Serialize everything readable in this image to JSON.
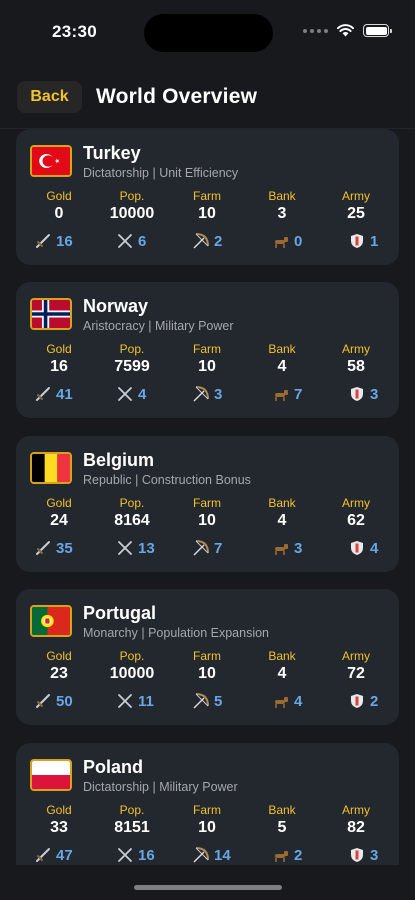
{
  "status_bar": {
    "time": "23:30"
  },
  "nav": {
    "back_label": "Back",
    "title": "World Overview"
  },
  "stat_labels": {
    "gold": "Gold",
    "pop": "Pop.",
    "farm": "Farm",
    "bank": "Bank",
    "army": "Army"
  },
  "unit_icons": [
    "sword-icon",
    "crossed-swords-icon",
    "bow-icon",
    "horse-icon",
    "shield-icon"
  ],
  "colors": {
    "accent": "#f2c12e",
    "unit_count": "#68a6e6",
    "card_bg": "#23272e",
    "background": "#17191d"
  },
  "countries": [
    {
      "name": "Turkey",
      "subtitle": "Dictatorship | Unit Efficiency",
      "flag": "turkey-flag",
      "gold": "0",
      "pop": "10000",
      "farm": "10",
      "bank": "3",
      "army": "25",
      "units": [
        "16",
        "6",
        "2",
        "0",
        "1"
      ]
    },
    {
      "name": "Norway",
      "subtitle": "Aristocracy | Military Power",
      "flag": "norway-flag",
      "gold": "16",
      "pop": "7599",
      "farm": "10",
      "bank": "4",
      "army": "58",
      "units": [
        "41",
        "4",
        "3",
        "7",
        "3"
      ]
    },
    {
      "name": "Belgium",
      "subtitle": "Republic | Construction Bonus",
      "flag": "belgium-flag",
      "gold": "24",
      "pop": "8164",
      "farm": "10",
      "bank": "4",
      "army": "62",
      "units": [
        "35",
        "13",
        "7",
        "3",
        "4"
      ]
    },
    {
      "name": "Portugal",
      "subtitle": "Monarchy | Population Expansion",
      "flag": "portugal-flag",
      "gold": "23",
      "pop": "10000",
      "farm": "10",
      "bank": "4",
      "army": "72",
      "units": [
        "50",
        "11",
        "5",
        "4",
        "2"
      ]
    },
    {
      "name": "Poland",
      "subtitle": "Dictatorship | Military Power",
      "flag": "poland-flag",
      "gold": "33",
      "pop": "8151",
      "farm": "10",
      "bank": "5",
      "army": "82",
      "units": [
        "47",
        "16",
        "14",
        "2",
        "3"
      ]
    }
  ]
}
